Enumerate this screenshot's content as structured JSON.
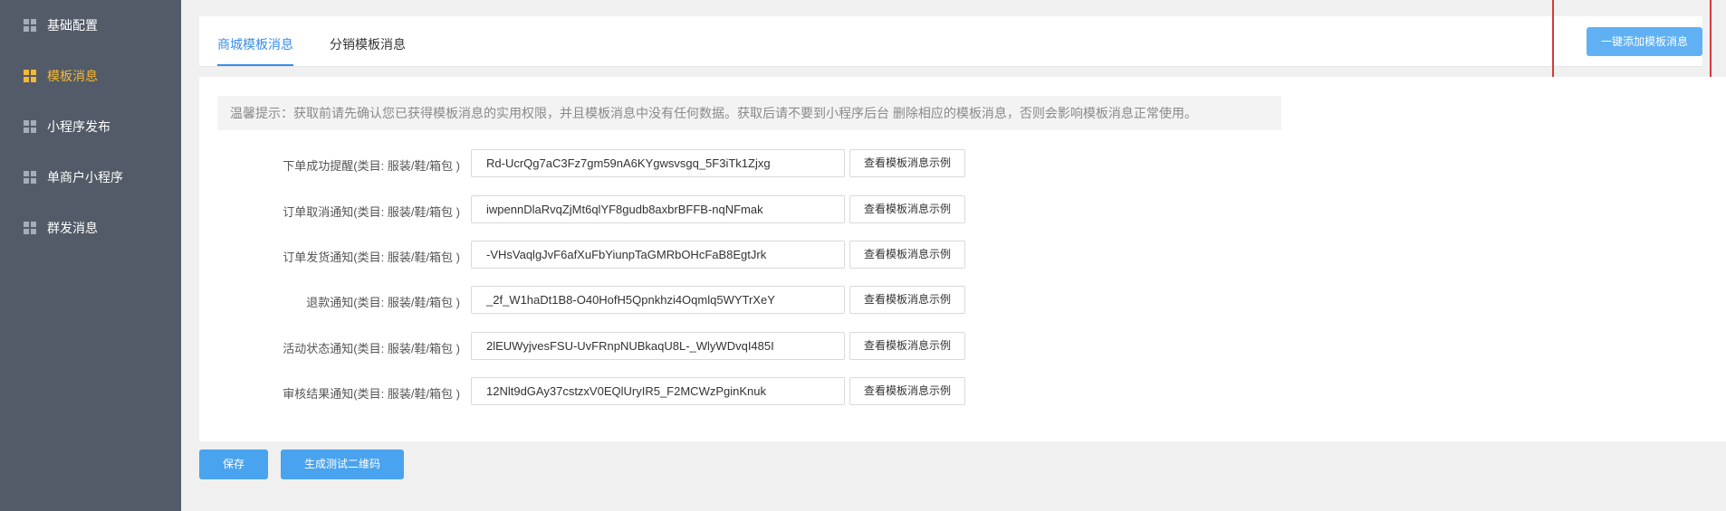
{
  "sidebar": {
    "items": [
      {
        "label": "基础配置",
        "active": false
      },
      {
        "label": "模板消息",
        "active": true
      },
      {
        "label": "小程序发布",
        "active": false
      },
      {
        "label": "单商户小程序",
        "active": false
      },
      {
        "label": "群发消息",
        "active": false
      }
    ],
    "active_color": "#f5b831"
  },
  "tabs": [
    {
      "label": "商城模板消息",
      "active": true
    },
    {
      "label": "分销模板消息",
      "active": false
    }
  ],
  "top_button_label": "一键添加模板消息",
  "hint": "温馨提示：获取前请先确认您已获得模板消息的实用权限，并且模板消息中没有任何数据。获取后请不要到小程序后台 删除相应的模板消息，否则会影响模板消息正常使用。",
  "rows": [
    {
      "label": "下单成功提醒(类目: 服装/鞋/箱包 )",
      "value": "Rd-UcrQg7aC3Fz7gm59nA6KYgwsvsgq_5F3iTk1Zjxg",
      "button": "查看模板消息示例"
    },
    {
      "label": "订单取消通知(类目: 服装/鞋/箱包 )",
      "value": "iwpennDlaRvqZjMt6qlYF8gudb8axbrBFFB-nqNFmak",
      "button": "查看模板消息示例"
    },
    {
      "label": "订单发货通知(类目: 服装/鞋/箱包 )",
      "value": "-VHsVaqlgJvF6afXuFbYiunpTaGMRbOHcFaB8EgtJrk",
      "button": "查看模板消息示例"
    },
    {
      "label": "退款通知(类目: 服装/鞋/箱包 )",
      "value": "_2f_W1haDt1B8-O40HofH5Qpnkhzi4Oqmlq5WYTrXeY",
      "button": "查看模板消息示例"
    },
    {
      "label": "活动状态通知(类目: 服装/鞋/箱包 )",
      "value": "2lEUWyjvesFSU-UvFRnpNUBkaqU8L-_WlyWDvqI485I",
      "button": "查看模板消息示例"
    },
    {
      "label": "审核结果通知(类目: 服装/鞋/箱包 )",
      "value": "12Nlt9dGAy37cstzxV0EQlUryIR5_F2MCWzPginKnuk",
      "button": "查看模板消息示例"
    }
  ],
  "bottom_buttons": {
    "save": "保存",
    "qrcode": "生成测试二维码"
  },
  "colors": {
    "primary": "#4aa3ee",
    "sidebar_bg": "#535b68",
    "highlight_box": "#d43b3b"
  }
}
